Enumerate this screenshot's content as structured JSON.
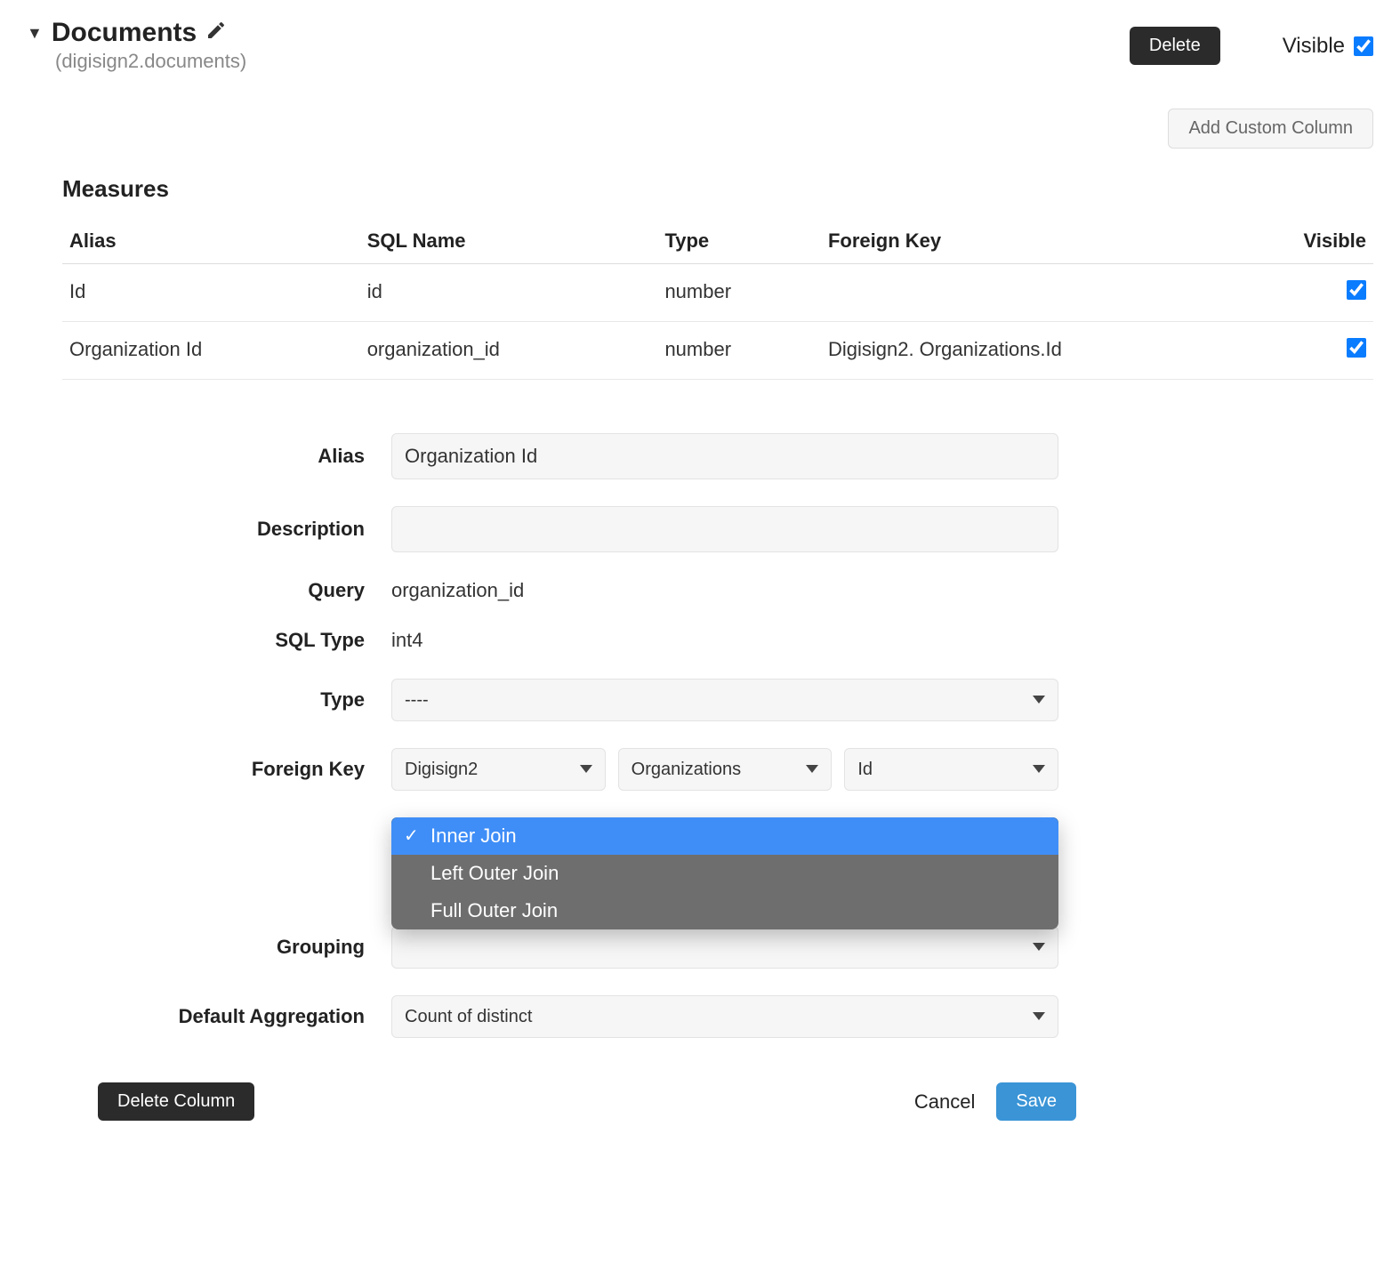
{
  "header": {
    "title": "Documents",
    "subtitle": "(digisign2.documents)",
    "delete_label": "Delete",
    "visible_label": "Visible",
    "visible_checked": true
  },
  "add_custom_column_label": "Add Custom Column",
  "measures": {
    "title": "Measures",
    "columns": {
      "alias": "Alias",
      "sql_name": "SQL Name",
      "type": "Type",
      "foreign_key": "Foreign Key",
      "visible": "Visible"
    },
    "rows": [
      {
        "alias": "Id",
        "sql_name": "id",
        "type": "number",
        "foreign_key": "",
        "visible": true
      },
      {
        "alias": "Organization Id",
        "sql_name": "organization_id",
        "type": "number",
        "foreign_key": "Digisign2. Organizations.Id",
        "visible": true
      }
    ]
  },
  "form": {
    "alias_label": "Alias",
    "alias_value": "Organization Id",
    "description_label": "Description",
    "description_value": "",
    "query_label": "Query",
    "query_value": "organization_id",
    "sql_type_label": "SQL Type",
    "sql_type_value": "int4",
    "type_label": "Type",
    "type_value": "----",
    "fk_label": "Foreign Key",
    "fk_schema": "Digisign2",
    "fk_table": "Organizations",
    "fk_column": "Id",
    "grouping_label": "Grouping",
    "default_agg_label": "Default Aggregation",
    "default_agg_value": "Count of distinct",
    "join_options": [
      "Inner Join",
      "Left Outer Join",
      "Full Outer Join"
    ],
    "join_selected": "Inner Join"
  },
  "footer": {
    "delete_column_label": "Delete Column",
    "cancel_label": "Cancel",
    "save_label": "Save"
  }
}
